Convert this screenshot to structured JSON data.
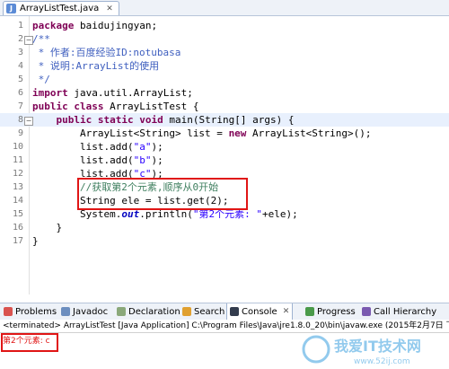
{
  "editor_tab": {
    "title": "ArrayListTest.java",
    "close": "✕"
  },
  "code_lines": [
    {
      "n": "1"
    },
    {
      "n": "2"
    },
    {
      "n": "3"
    },
    {
      "n": "4"
    },
    {
      "n": "5"
    },
    {
      "n": "6"
    },
    {
      "n": "7"
    },
    {
      "n": "8"
    },
    {
      "n": "9"
    },
    {
      "n": "10"
    },
    {
      "n": "11"
    },
    {
      "n": "12"
    },
    {
      "n": "13"
    },
    {
      "n": "14"
    },
    {
      "n": "15"
    },
    {
      "n": "16"
    },
    {
      "n": "17"
    }
  ],
  "code": {
    "l1_kw": "package",
    "l1_rest": " baidujingyan;",
    "l2": "/**",
    "l3_a": " * 作者:百度经验",
    "l3_b": "ID:notubasa",
    "l4_a": " * 说明:",
    "l4_b": "ArrayList",
    "l4_c": "的使用",
    "l5": " */",
    "l6_kw": "import",
    "l6_rest": " java.util.ArrayList;",
    "l7_kw1": "public",
    "l7_kw2": "class",
    "l7_rest": " ArrayListTest {",
    "l8_kw1": "public",
    "l8_kw2": "static",
    "l8_kw3": "void",
    "l8_rest": " main(String[] args) {",
    "l9_a": "ArrayList<String> list = ",
    "l9_kw": "new",
    "l9_b": " ArrayList<String>();",
    "l10_a": "list.add(",
    "l10_s": "\"a\"",
    "l11_s": "\"b\"",
    "l12_s": "\"c\"",
    "l_end": ");",
    "l13": "//获取第2个元素,顺序从0开始",
    "l14": "String ele = list.get(2);",
    "l15_a": "System.",
    "l15_f": "out",
    "l15_b": ".println(",
    "l15_s": "\"第2个元素: \"",
    "l15_c": "+ele);",
    "l16": "}",
    "l17": "}"
  },
  "views": {
    "problems": "Problems",
    "javadoc": "Javadoc",
    "declaration": "Declaration",
    "search": "Search",
    "console": "Console",
    "progress": "Progress",
    "call_hierarchy": "Call Hierarchy"
  },
  "console": {
    "status": "<terminated> ArrayListTest [Java Application] C:\\Program Files\\Java\\jre1.8.0_20\\bin\\javaw.exe (2015年2月7日 下",
    "output": "第2个元素: c"
  },
  "watermark": {
    "text": "我爱IT技术网",
    "url": "www.52ij.com"
  },
  "colors": {
    "keyword": "#7f0055",
    "string": "#2a00ff",
    "comment": "#3f7f5f",
    "highlight_box": "#e01515"
  }
}
